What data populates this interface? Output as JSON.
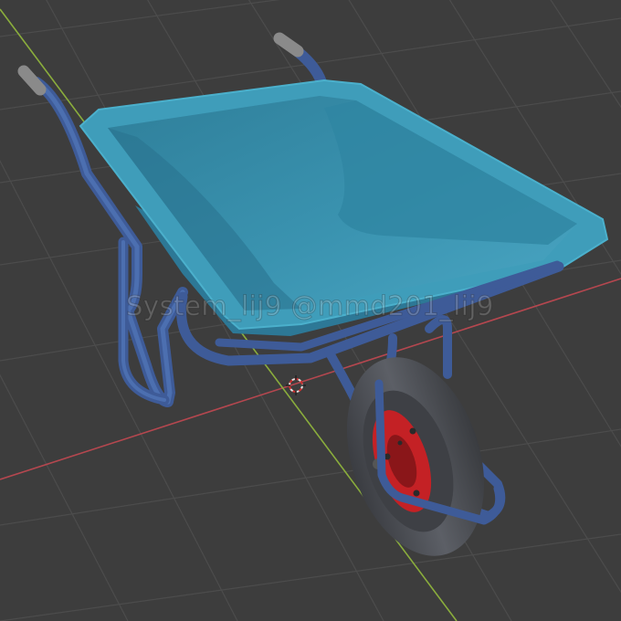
{
  "viewport": {
    "background": "#3d3d3d",
    "grid_color": "#4d4d4d",
    "x_axis_color": "#b5474f",
    "y_axis_color": "#8aad3c",
    "watermark": "System_lij9 @mmd201_lij9"
  },
  "model": {
    "tray_color": "#3a92ad",
    "frame_color": "#3e5b98",
    "tire_color": "#4b4d52",
    "rim_color": "#c42125",
    "grip_color": "#8a8a8a"
  }
}
